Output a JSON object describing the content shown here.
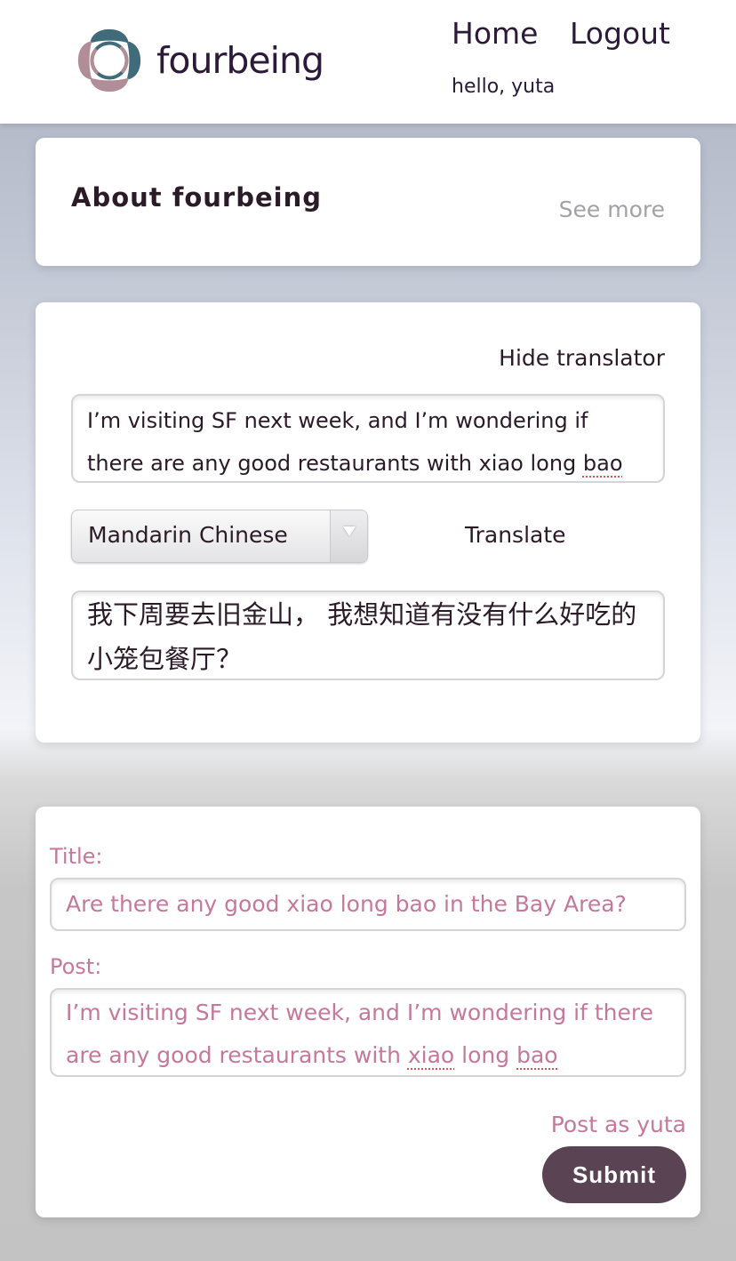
{
  "header": {
    "brand": "fourbeing",
    "nav": {
      "home": "Home",
      "logout": "Logout"
    },
    "greeting": "hello, yuta",
    "logo_colors": {
      "teal": "#3f6b7a",
      "mauve": "#b18d98"
    }
  },
  "about": {
    "title": "About fourbeing",
    "see_more": "See more"
  },
  "translator": {
    "hide_label": "Hide translator",
    "source_text_before": "I’m visiting SF next week, and I’m wondering if there are any good restaurants with xiao long ",
    "source_text_flagged": "bao",
    "language": "Mandarin Chinese",
    "translate_label": "Translate",
    "translated_text": "我下周要去旧金山， 我想知道有没有什么好吃的小笼包餐厅？"
  },
  "post_form": {
    "title_label": "Title:",
    "title_value": "Are there any good xiao long bao in the Bay Area?",
    "post_label": "Post:",
    "post_text_part1": "I’m visiting SF next week, and I’m wondering if there are any good restaurants with ",
    "post_text_flagged1": "xiao",
    "post_text_part2": " long ",
    "post_text_flagged2": "bao",
    "post_as": "Post as yuta",
    "submit_label": "Submit"
  },
  "colors": {
    "accent_pink": "#c6789c",
    "submit_bg": "#5a4352",
    "text_dark": "#2b1a28"
  }
}
